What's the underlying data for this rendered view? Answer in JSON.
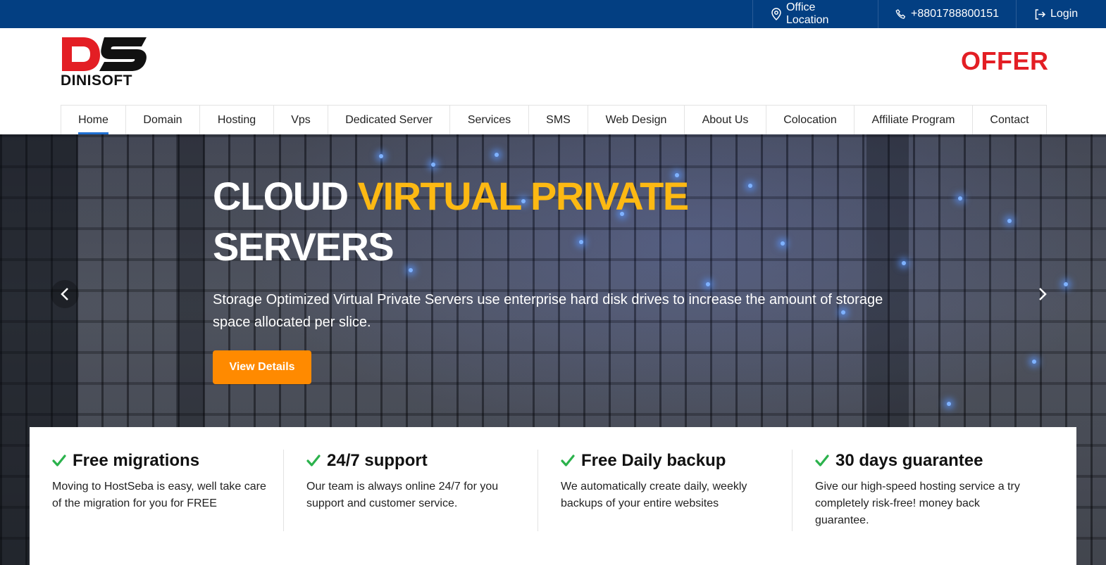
{
  "topbar": {
    "links": [
      {
        "label": "Office Location",
        "icon": "location-pin-icon"
      },
      {
        "label": "+8801788800151",
        "icon": "phone-icon"
      },
      {
        "label": "Login",
        "icon": "login-icon"
      }
    ],
    "background": "#033f82"
  },
  "header": {
    "logo_monogram": "DS",
    "logo_text": "DINISOFT",
    "offer_label": "OFFER",
    "offer_color": "#e31e24"
  },
  "nav": {
    "items": [
      "Home",
      "Domain",
      "Hosting",
      "Vps",
      "Dedicated Server",
      "Services",
      "SMS",
      "Web Design",
      "About Us",
      "Colocation",
      "Affiliate Program",
      "Contact"
    ],
    "active": "Home",
    "active_color": "#1f6fd1"
  },
  "hero": {
    "title_part1": "CLOUD ",
    "title_accent": "VIRTUAL PRIVATE",
    "title_part2": "SERVERS",
    "accent_color": "#fdb913",
    "description": "Storage Optimized Virtual Private Servers use enterprise hard disk drives to increase the amount of storage space allocated per slice.",
    "button_label": "View Details",
    "button_color": "#ff8a00"
  },
  "features": [
    {
      "title": "Free migrations",
      "text": "Moving to HostSeba is easy, well take care of the migration for you for FREE",
      "icon": "checkmark-icon"
    },
    {
      "title": "24/7 support",
      "text": "Our team is always online 24/7 for you support and customer service.",
      "icon": "checkmark-icon"
    },
    {
      "title": "Free Daily backup",
      "text": "We automatically create daily, weekly backups of your entire websites",
      "icon": "checkmark-icon"
    },
    {
      "title": "30 days guarantee",
      "text": "Give our high-speed hosting service a try completely risk-free! money back guarantee.",
      "icon": "checkmark-icon"
    }
  ]
}
